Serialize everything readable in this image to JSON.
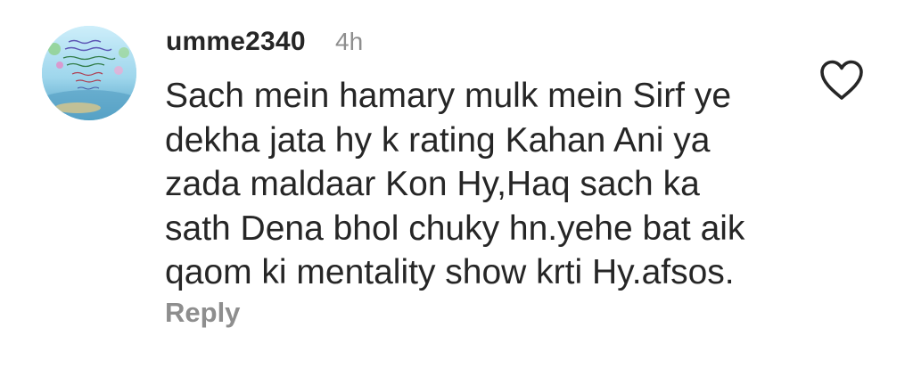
{
  "comment": {
    "username": "umme2340",
    "timestamp": "4h",
    "text_lines": [
      "Sach mein hamary mulk mein Sirf ye",
      "dekha jata hy k rating Kahan Ani ya",
      "zada maldaar Kon Hy,Haq sach ka",
      "sath Dena bhol chuky hn.yehe bat aik",
      "qaom ki mentality show krti Hy.afsos."
    ],
    "reply_label": "Reply",
    "like_icon": "heart-outline-icon"
  },
  "colors": {
    "primary_text": "#262626",
    "secondary_text": "#8e8e8e",
    "background": "#ffffff"
  }
}
